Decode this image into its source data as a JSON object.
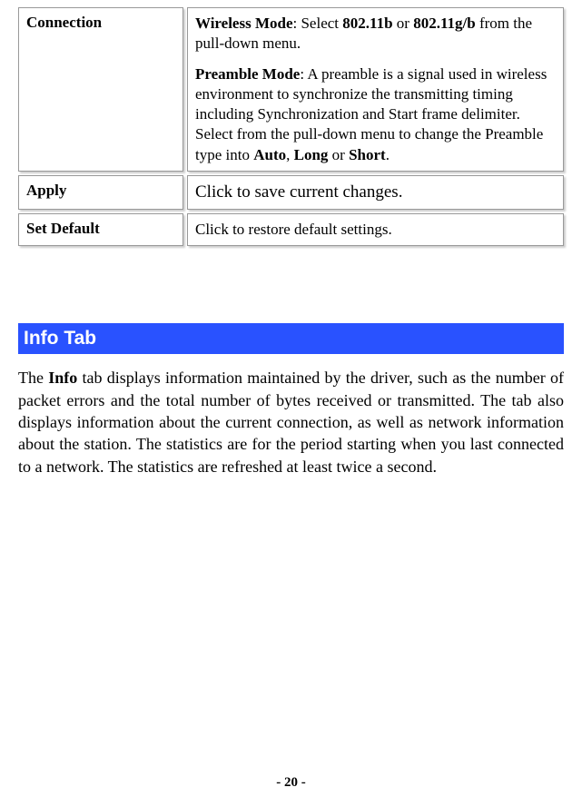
{
  "table": {
    "row1": {
      "label": "Connection",
      "p1_bold1": "Wireless Mode",
      "p1_text1": ": Select ",
      "p1_bold2": "802.11b",
      "p1_text2": " or ",
      "p1_bold3": "802.11g/b",
      "p1_text3": " from the pull-down menu.",
      "p2_bold1": "Preamble Mode",
      "p2_text1": ": A preamble is a signal used in wireless environment to synchronize the transmitting timing including Synchronization and Start frame delimiter. Select from the pull-down menu to change the Preamble type into ",
      "p2_bold2": "Auto",
      "p2_text2": ", ",
      "p2_bold3": "Long",
      "p2_text3": " or ",
      "p2_bold4": "Short",
      "p2_text4": "."
    },
    "row2": {
      "label": "Apply",
      "desc": "Click to save current changes."
    },
    "row3": {
      "label": "Set Default",
      "desc": "Click to restore default settings."
    }
  },
  "section": {
    "title": "Info Tab",
    "body_pre": "The ",
    "body_bold": "Info",
    "body_post": " tab displays information maintained by the driver, such as the number of packet errors and the total number of bytes received or transmitted. The tab also displays information about the current connection, as well as network information about the station. The statistics are for the period starting when you last connected to a network. The statistics are refreshed at least twice a second."
  },
  "page_number": "- 20 -"
}
